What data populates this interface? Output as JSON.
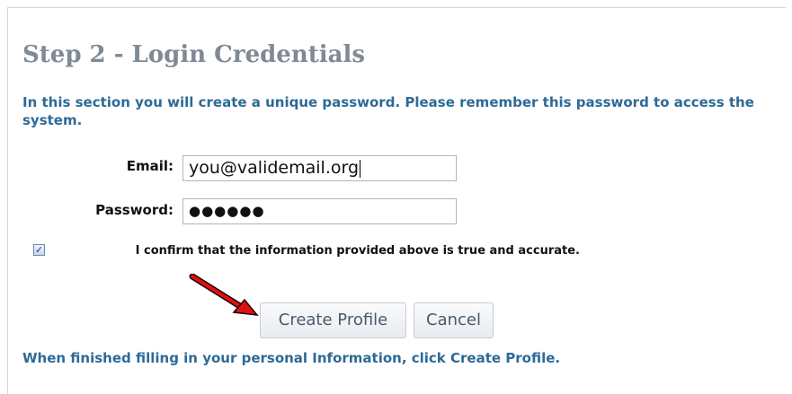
{
  "section": {
    "heading": "Step 2 - Login Credentials",
    "intro": "In this section you will create a unique password. Please remember this password to access the system."
  },
  "form": {
    "email_label": "Email:",
    "email_value": "you@validemail.org",
    "password_label": "Password:",
    "password_value": "●●●●●●",
    "confirm_checked": true,
    "confirm_text": "I confirm that the information provided above is true and accurate."
  },
  "buttons": {
    "create_label": "Create Profile",
    "cancel_label": "Cancel"
  },
  "footer": {
    "note": "When finished filling in your personal Information, click Create Profile."
  },
  "colors": {
    "heading": "#7f8a96",
    "accent_text": "#2d6a97",
    "annotation_arrow": "#e01010"
  }
}
